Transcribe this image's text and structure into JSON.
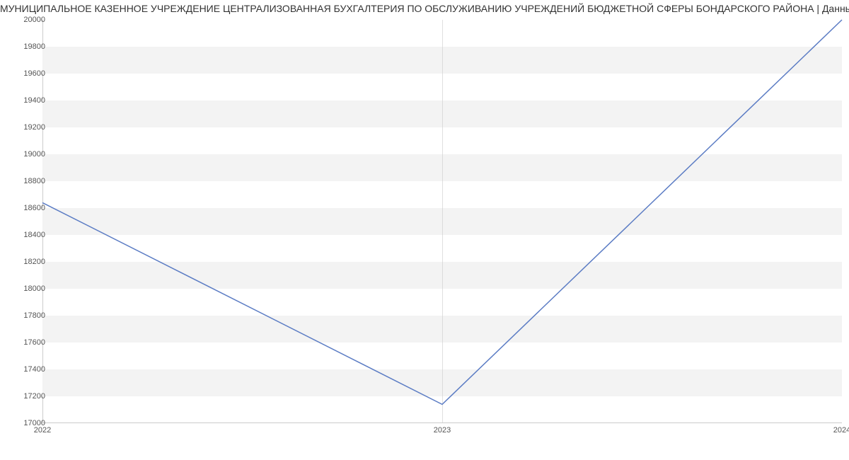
{
  "chart_data": {
    "type": "line",
    "title": "МУНИЦИПАЛЬНОЕ КАЗЕННОЕ УЧРЕЖДЕНИЕ ЦЕНТРАЛИЗОВАННАЯ БУХГАЛТЕРИЯ ПО ОБСЛУЖИВАНИЮ УЧРЕЖДЕНИЙ БЮДЖЕТНОЙ СФЕРЫ БОНДАРСКОГО РАЙОНА | Данны",
    "categories": [
      "2022",
      "2023",
      "2024"
    ],
    "values": [
      18640,
      17140,
      20000
    ],
    "ylim": [
      17000,
      20000
    ],
    "ystep": 200,
    "yticks": [
      17000,
      17200,
      17400,
      17600,
      17800,
      18000,
      18200,
      18400,
      18600,
      18800,
      19000,
      19200,
      19400,
      19600,
      19800,
      20000
    ],
    "line_color": "#5b7cc4"
  }
}
